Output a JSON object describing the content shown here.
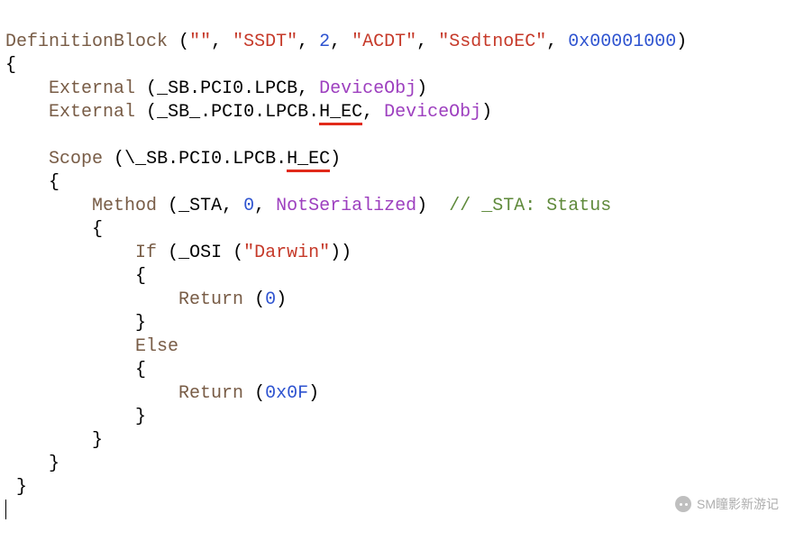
{
  "tokens": {
    "def_block": "DefinitionBlock",
    "external": "External",
    "scope": "Scope",
    "method": "Method",
    "if": "If",
    "else": "Else",
    "return": "Return",
    "not_serialized": "NotSerialized",
    "device_obj": "DeviceObj"
  },
  "strings": {
    "empty": "\"\"",
    "ssdt": "\"SSDT\"",
    "acdt": "\"ACDT\"",
    "ssdtnoec": "\"SsdtnoEC\"",
    "darwin": "\"Darwin\""
  },
  "numbers": {
    "two": "2",
    "tablerev": "0x00001000",
    "zero": "0",
    "zero2": "0",
    "oxf": "0x0F"
  },
  "idents": {
    "ext1_path": "_SB.PCI0.LPCB",
    "ext2_path_pre": "_SB_.PCI0.LPCB.",
    "ext2_path_hec": "H_EC",
    "scope_path_pre": "\\_SB.PCI0.LPCB.",
    "scope_path_hec": "H_EC",
    "sta": "_STA",
    "osi": "_OSI"
  },
  "comment": "// _STA: Status",
  "watermark_text": "SM瞳影新游记",
  "punct": {
    "sp": " ",
    "open_paren": "(",
    "close_paren": ")",
    "comma_sp": ", ",
    "open_brace": "{",
    "close_brace": "}",
    "close_paren_paren": "))"
  },
  "indent": {
    "i0": "",
    "i1": "    ",
    "i2": "        ",
    "i3": "            ",
    "i4": "                "
  }
}
